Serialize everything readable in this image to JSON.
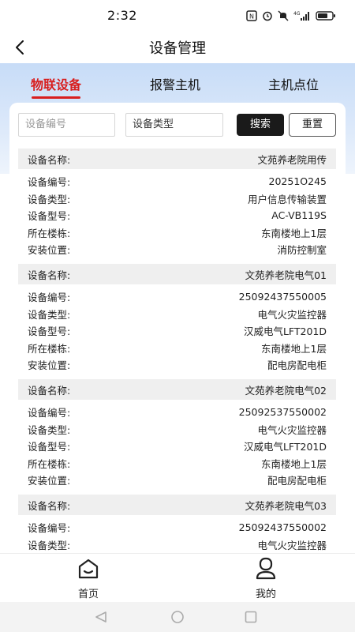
{
  "status_bar": {
    "time": "2:32",
    "network": "4G",
    "icons": [
      "nfc-icon",
      "alarm-icon",
      "mute-icon",
      "signal-icon",
      "battery-icon"
    ]
  },
  "header": {
    "title": "设备管理",
    "back_icon": "chevron-left-icon"
  },
  "tabs": [
    {
      "label": "物联设备",
      "active": true
    },
    {
      "label": "报警主机",
      "active": false
    },
    {
      "label": "主机点位",
      "active": false
    }
  ],
  "search": {
    "device_number_placeholder": "设备编号",
    "device_type_placeholder": "设备类型",
    "search_label": "搜索",
    "reset_label": "重置"
  },
  "field_labels": {
    "name": "设备名称:",
    "number": "设备编号:",
    "type": "设备类型:",
    "model": "设备型号:",
    "building": "所在楼栋:",
    "location": "安装位置:"
  },
  "devices": [
    {
      "name": "文苑养老院用传",
      "number": "20251O245",
      "type": "用户信息传输装置",
      "model": "AC-VB119S",
      "building": "东南楼地上1层",
      "location": "消防控制室"
    },
    {
      "name": "文苑养老院电气01",
      "number": "25092437550005",
      "type": "电气火灾监控器",
      "model": "汉威电气LFT201D",
      "building": "东南楼地上1层",
      "location": "配电房配电柜"
    },
    {
      "name": "文苑养老院电气02",
      "number": "25092537550002",
      "type": "电气火灾监控器",
      "model": "汉威电气LFT201D",
      "building": "东南楼地上1层",
      "location": "配电房配电柜"
    },
    {
      "name": "文苑养老院电气03",
      "number": "25092437550002",
      "type": "电气火灾监控器",
      "model": "",
      "building": "",
      "location": ""
    }
  ],
  "bottom_nav": [
    {
      "label": "首页",
      "icon": "home-icon"
    },
    {
      "label": "我的",
      "icon": "user-icon"
    }
  ],
  "colors": {
    "accent": "#d81e1e",
    "band_top": "#c7dcf7",
    "button_dark": "#1a1a1a",
    "row_header_bg": "#efefef"
  }
}
